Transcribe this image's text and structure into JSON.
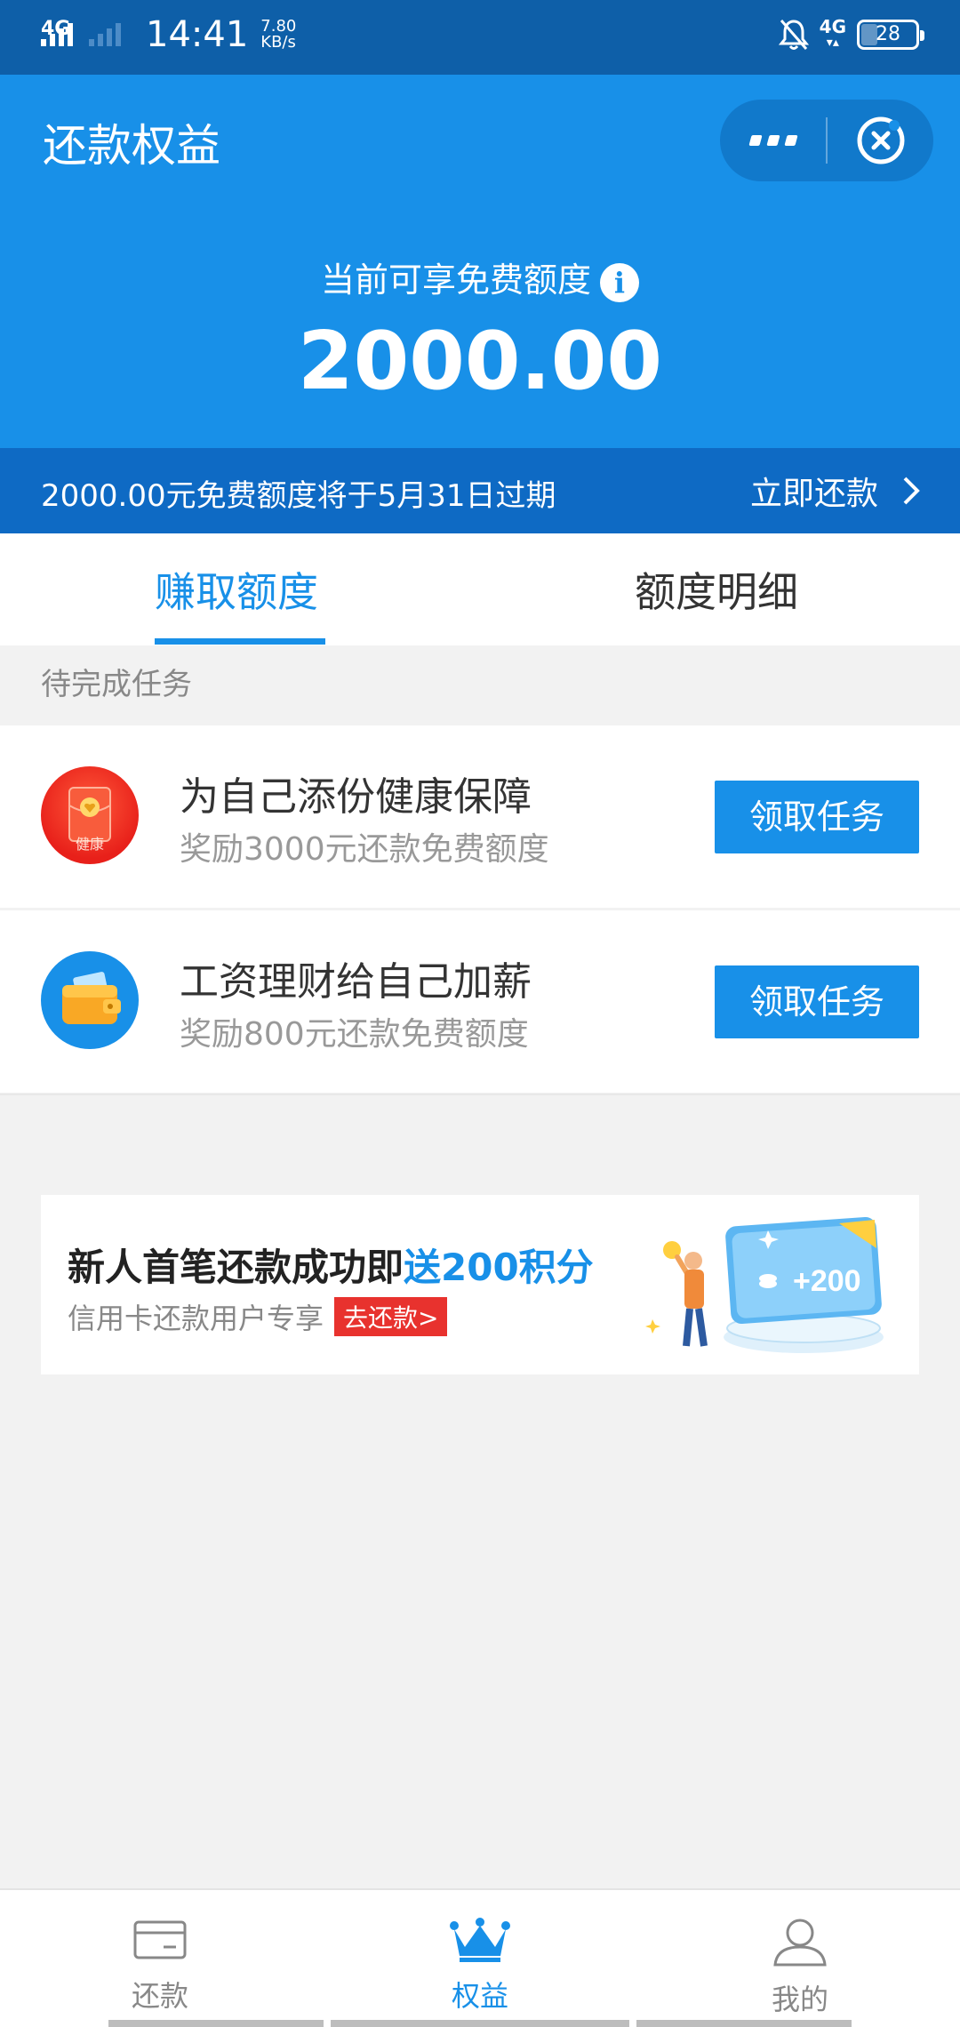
{
  "status_bar": {
    "network": "4G",
    "time": "14:41",
    "speed_value": "7.80",
    "speed_unit": "KB/s",
    "network2": "4G",
    "battery": "28"
  },
  "header": {
    "title": "还款权益",
    "quota_label": "当前可享免费额度",
    "quota_value": "2000.00"
  },
  "expiry": {
    "message": "2000.00元免费额度将于5月31日过期",
    "action": "立即还款"
  },
  "tabs": [
    {
      "label": "赚取额度",
      "active": true
    },
    {
      "label": "额度明细",
      "active": false
    }
  ],
  "section_title": "待完成任务",
  "tasks": [
    {
      "title": "为自己添份健康保障",
      "subtitle": "奖励3000元还款免费额度",
      "button": "领取任务",
      "icon_text": "健康"
    },
    {
      "title": "工资理财给自己加薪",
      "subtitle": "奖励800元还款免费额度",
      "button": "领取任务"
    }
  ],
  "promo": {
    "title_main": "新人首笔还款成功即",
    "title_highlight": "送200积分",
    "subtitle": "信用卡还款用户专享",
    "button": "去还款>",
    "art_value": "+200"
  },
  "bottom_nav": [
    {
      "label": "还款",
      "icon": "card-icon"
    },
    {
      "label": "权益",
      "icon": "crown-icon",
      "active": true
    },
    {
      "label": "我的",
      "icon": "user-icon"
    }
  ],
  "colors": {
    "primary": "#1890e8",
    "status_bar": "#0e5fa8",
    "expiry_strip": "#0e6ac4",
    "promo_button": "#e8322e"
  }
}
